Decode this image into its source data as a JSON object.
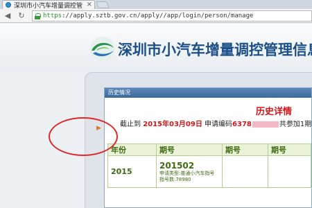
{
  "browser": {
    "tab_title": "深圳市小汽车增量调控管",
    "tab_close": "×",
    "url_scheme": "https",
    "url_rest": "://apply.sztb.gov.cn/apply//app/login/person/manage"
  },
  "site": {
    "title": "深圳市小汽车增量调控管理信息系"
  },
  "dialog": {
    "title": "历史情况",
    "heading": "历史详情",
    "info": {
      "prefix": "截止到 ",
      "date": "2015年03月09日",
      "mid": " 申请编码",
      "code": "6378",
      "suffix": "共参加1期"
    },
    "table": {
      "headers": [
        "年份",
        "期号",
        "期号",
        "期号"
      ],
      "row": {
        "year": "2015",
        "period": "201502",
        "apply_type": "申请类型:普通小汽车指号",
        "index_no": "指号数:78980"
      }
    }
  },
  "colors": {
    "accent_red": "#d0161b",
    "title_blue": "#1b4f86",
    "table_green": "#3f6a12"
  }
}
